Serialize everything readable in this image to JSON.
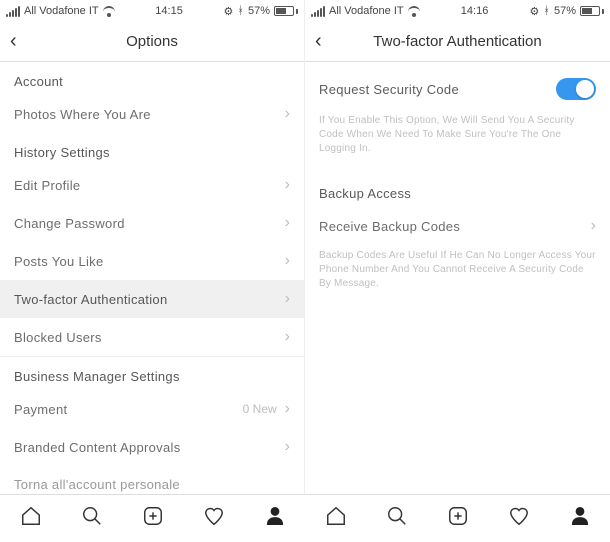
{
  "left": {
    "status": {
      "carrier": "All Vodafone IT",
      "time": "14:15",
      "battery": "57%"
    },
    "header": {
      "title": "Options"
    },
    "sections": {
      "account": {
        "header": "Account",
        "items": {
          "photos_of_you": "Photos Where You Are"
        }
      },
      "history": {
        "header": "History Settings",
        "items": {
          "edit_profile": "Edit Profile",
          "change_password": "Change Password",
          "posts_you_like": "Posts You Like",
          "two_factor": "Two-factor Authentication",
          "blocked_users": "Blocked Users"
        }
      },
      "business": {
        "header": "Business Manager Settings",
        "items": {
          "payments": {
            "label": "Payment",
            "meta": "0 New"
          },
          "branded_content": "Branded Content Approvals",
          "back_personal": "Torna all'account personale"
        }
      }
    }
  },
  "right": {
    "status": {
      "carrier": "All Vodafone IT",
      "time": "14:16",
      "battery": "57%"
    },
    "header": {
      "title": "Two-factor Authentication"
    },
    "request_code": {
      "label": "Request Security Code",
      "enabled": true
    },
    "help1": "If You Enable This Option, We Will Send You A Security Code When We Need To Make Sure You're The One Logging In.",
    "backup": {
      "header": "Backup Access",
      "receive": "Receive Backup Codes"
    },
    "help2": "Backup Codes Are Useful If He Can No Longer Access Your Phone Number And You Cannot Receive A Security Code By Message."
  }
}
